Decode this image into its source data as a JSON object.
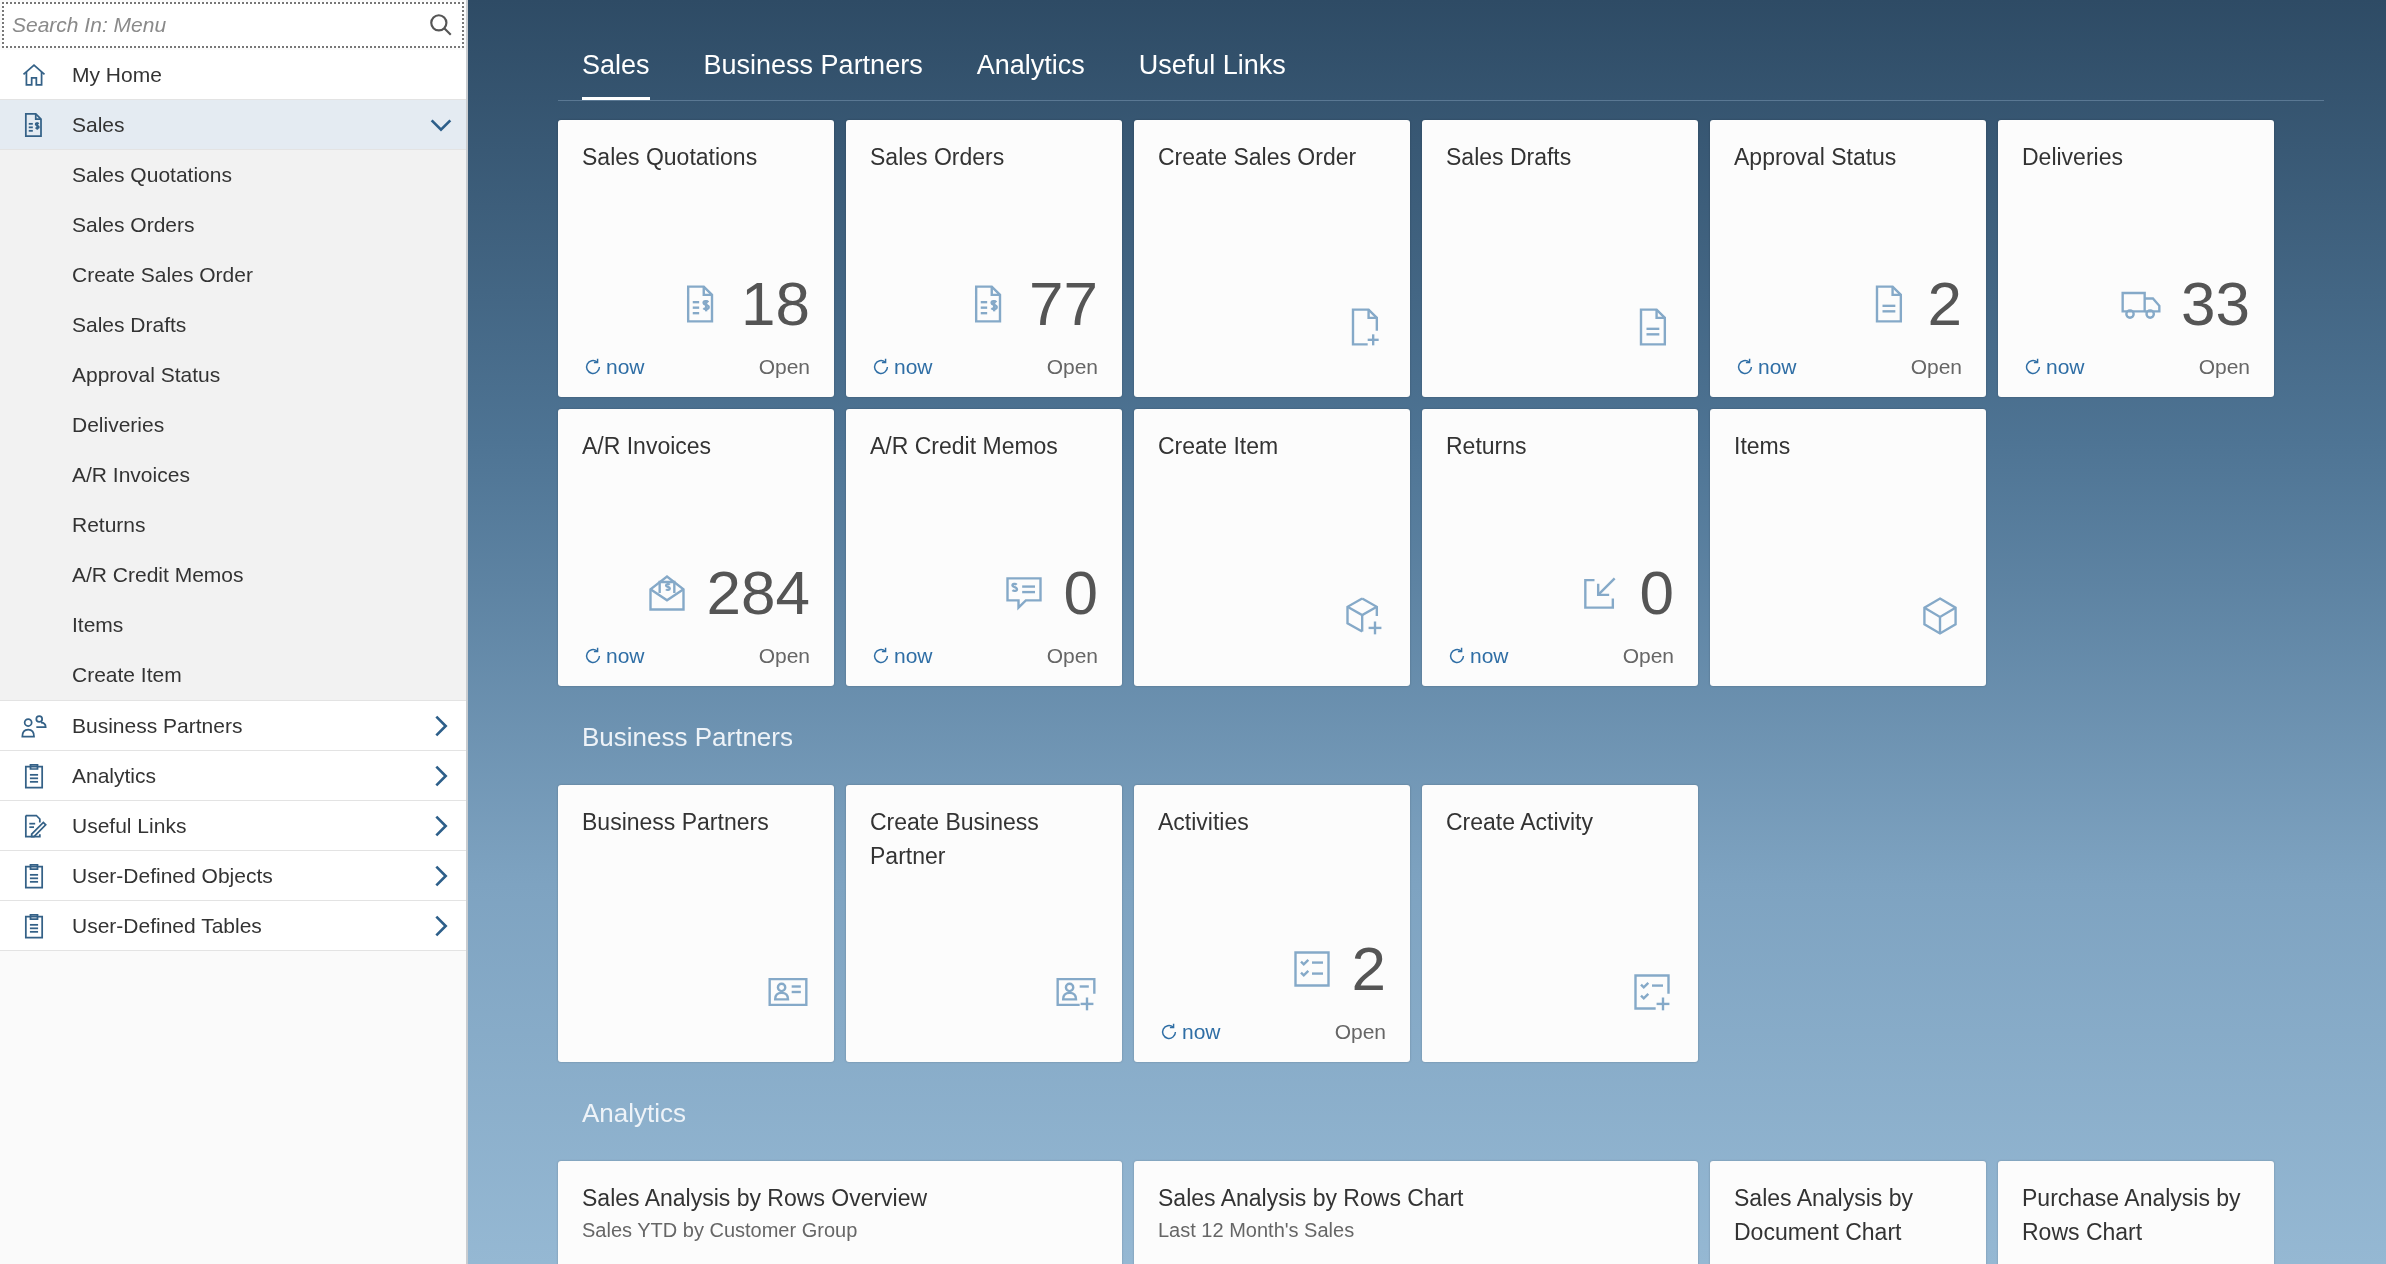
{
  "search": {
    "placeholder": "Search In: Menu"
  },
  "menu": [
    {
      "label": "My Home",
      "kind": "link",
      "selected": false
    },
    {
      "label": "Sales",
      "kind": "group",
      "selected": true,
      "expanded": true,
      "children": [
        {
          "label": "Sales Quotations"
        },
        {
          "label": "Sales Orders"
        },
        {
          "label": "Create Sales Order"
        },
        {
          "label": "Sales Drafts"
        },
        {
          "label": "Approval Status"
        },
        {
          "label": "Deliveries"
        },
        {
          "label": "A/R Invoices"
        },
        {
          "label": "Returns"
        },
        {
          "label": "A/R Credit Memos"
        },
        {
          "label": "Items"
        },
        {
          "label": "Create Item"
        }
      ]
    },
    {
      "label": "Business Partners",
      "kind": "group",
      "selected": false,
      "expanded": false
    },
    {
      "label": "Analytics",
      "kind": "group",
      "selected": false,
      "expanded": false
    },
    {
      "label": "Useful Links",
      "kind": "group",
      "selected": false,
      "expanded": false
    },
    {
      "label": "User-Defined Objects",
      "kind": "group",
      "selected": false,
      "expanded": false
    },
    {
      "label": "User-Defined Tables",
      "kind": "group",
      "selected": false,
      "expanded": false
    }
  ],
  "tabs": [
    {
      "label": "Sales",
      "selected": true
    },
    {
      "label": "Business Partners",
      "selected": false
    },
    {
      "label": "Analytics",
      "selected": false
    },
    {
      "label": "Useful Links",
      "selected": false
    }
  ],
  "sections": [
    {
      "tiles": [
        {
          "kind": "kpi",
          "title": "Sales Quotations",
          "count": "18",
          "refresh": "now",
          "status": "Open"
        },
        {
          "kind": "kpi",
          "title": "Sales Orders",
          "count": "77",
          "refresh": "now",
          "status": "Open"
        },
        {
          "kind": "launch",
          "title": "Create Sales Order"
        },
        {
          "kind": "launch",
          "title": "Sales Drafts"
        },
        {
          "kind": "kpi",
          "title": "Approval Status",
          "count": "2",
          "refresh": "now",
          "status": "Open"
        },
        {
          "kind": "kpi",
          "title": "Deliveries",
          "count": "33",
          "refresh": "now",
          "status": "Open"
        },
        {
          "kind": "kpi",
          "title": "A/R Invoices",
          "count": "284",
          "refresh": "now",
          "status": "Open"
        },
        {
          "kind": "kpi",
          "title": "A/R Credit Memos",
          "count": "0",
          "refresh": "now",
          "status": "Open"
        },
        {
          "kind": "launch",
          "title": "Create Item"
        },
        {
          "kind": "kpi",
          "title": "Returns",
          "count": "0",
          "refresh": "now",
          "status": "Open"
        },
        {
          "kind": "launch",
          "title": "Items"
        }
      ]
    },
    {
      "title": "Business Partners",
      "tiles": [
        {
          "kind": "launch",
          "title": "Business Partners"
        },
        {
          "kind": "launch",
          "title": "Create Business Partner"
        },
        {
          "kind": "kpi",
          "title": "Activities",
          "count": "2",
          "refresh": "now",
          "status": "Open"
        },
        {
          "kind": "launch",
          "title": "Create Activity"
        }
      ]
    },
    {
      "title": "Analytics",
      "tiles": [
        {
          "kind": "wide",
          "title": "Sales Analysis by Rows Overview",
          "subtitle": "Sales YTD by Customer Group"
        },
        {
          "kind": "wide",
          "title": "Sales Analysis by Rows Chart",
          "subtitle": "Last 12 Month's Sales"
        },
        {
          "kind": "text",
          "title": "Sales Analysis by Document Chart"
        },
        {
          "kind": "text",
          "title": "Purchase Analysis by Rows Chart"
        }
      ]
    }
  ]
}
